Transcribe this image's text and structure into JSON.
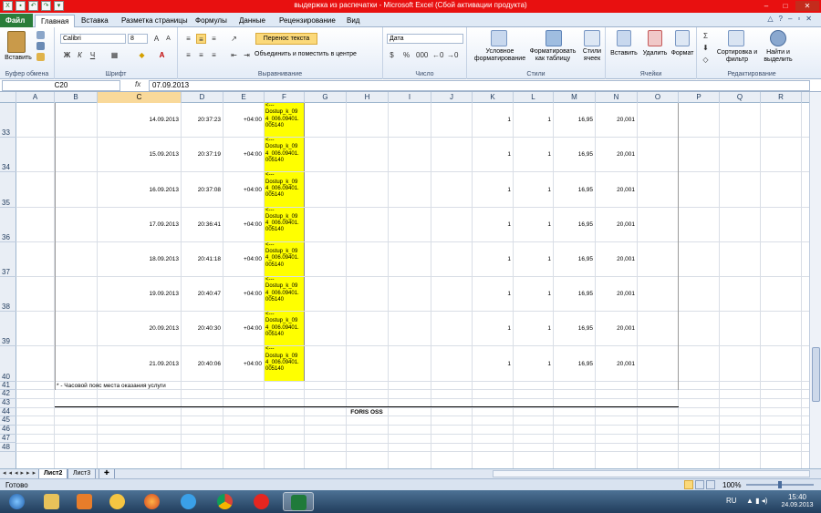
{
  "window": {
    "title": "выдержка из распечатки  -  Microsoft Excel (Сбой активации продукта)"
  },
  "ribbon_tabs": [
    {
      "label": "Файл"
    },
    {
      "label": "Главная"
    },
    {
      "label": "Вставка"
    },
    {
      "label": "Разметка страницы"
    },
    {
      "label": "Формулы"
    },
    {
      "label": "Данные"
    },
    {
      "label": "Рецензирование"
    },
    {
      "label": "Вид"
    }
  ],
  "ribbon": {
    "paste_label": "Вставить",
    "clipboard_group": "Буфер обмена",
    "font_name": "Calibri",
    "font_size": "8",
    "font_group": "Шрифт",
    "bold": "Ж",
    "italic": "К",
    "underline": "Ч",
    "wrap_text": "Перенос текста",
    "merge_center": "Объединить и поместить в центре",
    "alignment_group": "Выравнивание",
    "number_format": "Дата",
    "number_group": "Число",
    "cond_format": "Условное форматирование",
    "format_table": "Форматировать как таблицу",
    "cell_styles": "Стили ячеек",
    "styles_group": "Стили",
    "insert": "Вставить",
    "delete": "Удалить",
    "format": "Формат",
    "cells_group": "Ячейки",
    "sort_filter": "Сортировка и фильтр",
    "find_select": "Найти и выделить",
    "editing_group": "Редактирование"
  },
  "formula_bar": {
    "name_box": "C20",
    "fx": "fx",
    "value": "07.09.2013"
  },
  "columns": [
    "A",
    "B",
    "C",
    "D",
    "E",
    "F",
    "G",
    "H",
    "I",
    "J",
    "K",
    "L",
    "M",
    "N",
    "O",
    "P",
    "Q",
    "R"
  ],
  "selected_column": "C",
  "data_rows": [
    {
      "row": "33",
      "date": "14.09.2013",
      "time": "20:37:23",
      "tz": "+04:00",
      "f_lines": [
        "<---",
        "Dostup_k_09",
        "4_006.09401.",
        "005140"
      ],
      "k": "1",
      "l": "1",
      "m": "16,95",
      "n": "20,001"
    },
    {
      "row": "34",
      "date": "15.09.2013",
      "time": "20:37:19",
      "tz": "+04:00",
      "f_lines": [
        "<---",
        "Dostup_k_09",
        "4_006.09401.",
        "005140"
      ],
      "k": "1",
      "l": "1",
      "m": "16,95",
      "n": "20,001"
    },
    {
      "row": "35",
      "date": "16.09.2013",
      "time": "20:37:08",
      "tz": "+04:00",
      "f_lines": [
        "<---",
        "Dostup_k_09",
        "4_006.09401.",
        "005140"
      ],
      "k": "1",
      "l": "1",
      "m": "16,95",
      "n": "20,001"
    },
    {
      "row": "36",
      "date": "17.09.2013",
      "time": "20:36:41",
      "tz": "+04:00",
      "f_lines": [
        "<---",
        "Dostup_k_09",
        "4_006.09401.",
        "005140"
      ],
      "k": "1",
      "l": "1",
      "m": "16,95",
      "n": "20,001"
    },
    {
      "row": "37",
      "date": "18.09.2013",
      "time": "20:41:18",
      "tz": "+04:00",
      "f_lines": [
        "<---",
        "Dostup_k_09",
        "4_006.09401.",
        "005140"
      ],
      "k": "1",
      "l": "1",
      "m": "16,95",
      "n": "20,001"
    },
    {
      "row": "38",
      "date": "19.09.2013",
      "time": "20:40:47",
      "tz": "+04:00",
      "f_lines": [
        "<---",
        "Dostup_k_09",
        "4_006.09401.",
        "005140"
      ],
      "k": "1",
      "l": "1",
      "m": "16,95",
      "n": "20,001"
    },
    {
      "row": "39",
      "date": "20.09.2013",
      "time": "20:40:30",
      "tz": "+04:00",
      "f_lines": [
        "<---",
        "Dostup_k_09",
        "4_006.09401.",
        "005140"
      ],
      "k": "1",
      "l": "1",
      "m": "16,95",
      "n": "20,001"
    },
    {
      "row": "40",
      "date": "21.09.2013",
      "time": "20:40:06",
      "tz": "+04:00",
      "f_lines": [
        "<---",
        "Dostup_k_09",
        "4_006.09401.",
        "005140"
      ],
      "k": "1",
      "l": "1",
      "m": "16,95",
      "n": "20,001"
    }
  ],
  "small_rows": [
    "41",
    "42",
    "43",
    "44",
    "45",
    "46",
    "47",
    "48"
  ],
  "footnote": "* - Часовой пояс места оказания услуги",
  "footer_title": "FORIS OSS",
  "sheets": [
    {
      "label": "Лист2"
    },
    {
      "label": "Лист3"
    }
  ],
  "status": {
    "ready": "Готово",
    "zoom": "100%"
  },
  "tray": {
    "lang": "RU",
    "time": "15:40",
    "date": "24.09.2013"
  },
  "colors": {
    "title_bar": "#e81010",
    "file_tab": "#2a7d3a",
    "highlight_cells": "#ffff00",
    "selected_header": "#f9d99a"
  }
}
